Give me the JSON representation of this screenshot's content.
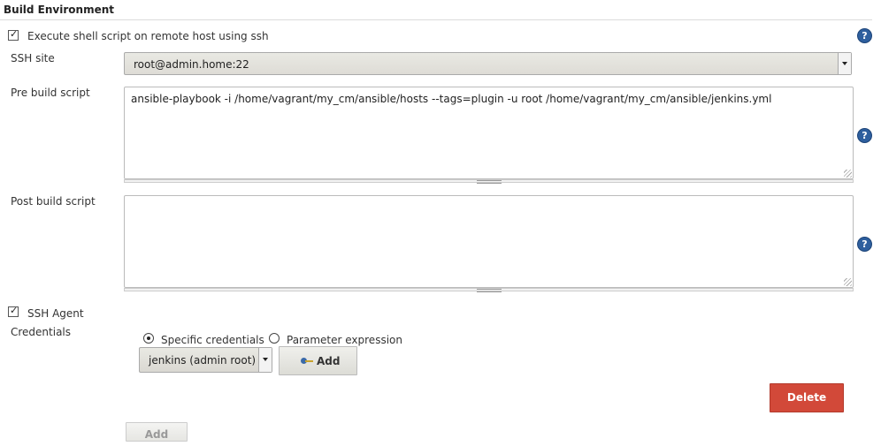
{
  "section": {
    "title": "Build Environment"
  },
  "remote_shell": {
    "checked": true,
    "label": "Execute shell script on remote host using ssh",
    "ssh_site_label": "SSH site",
    "ssh_site_value": "root@admin.home:22",
    "pre_build_label": "Pre build script",
    "pre_build_value": "ansible-playbook -i /home/vagrant/my_cm/ansible/hosts --tags=plugin -u root  /home/vagrant/my_cm/ansible/jenkins.yml",
    "post_build_label": "Post build script",
    "post_build_value": ""
  },
  "ssh_agent": {
    "checked": true,
    "label": "SSH Agent",
    "credentials_label": "Credentials",
    "radio_specific": "Specific credentials",
    "radio_parameter": "Parameter expression",
    "selected_radio": "specific",
    "credential_value": "jenkins (admin root)",
    "add_label": "Add"
  },
  "actions": {
    "delete_label": "Delete",
    "add_step_label": "Add"
  },
  "help": {
    "glyph": "?"
  },
  "checkbox": {
    "glyph": "✓"
  },
  "colors": {
    "delete": "#d24939",
    "help": "#2e5f9e"
  }
}
